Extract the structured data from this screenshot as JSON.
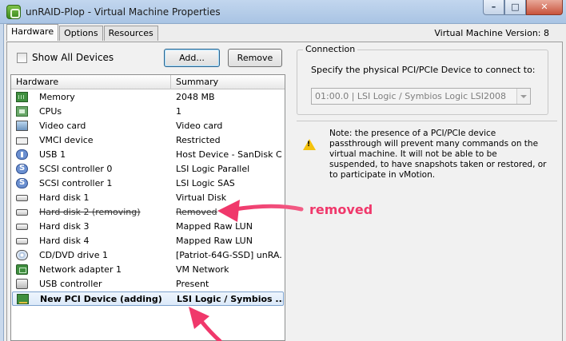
{
  "window": {
    "title": "unRAID-Plop - Virtual Machine Properties"
  },
  "tabs": [
    {
      "label": "Hardware",
      "active": true
    },
    {
      "label": "Options",
      "active": false
    },
    {
      "label": "Resources",
      "active": false
    }
  ],
  "vm_version": "Virtual Machine Version: 8",
  "toolbar": {
    "show_all_devices": "Show All Devices",
    "show_all_devices_checked": false,
    "add_label": "Add...",
    "remove_label": "Remove"
  },
  "device_list": {
    "columns": {
      "hardware": "Hardware",
      "summary": "Summary"
    },
    "rows": [
      {
        "name": "Memory",
        "summary": "2048 MB",
        "icon": "memory-icon"
      },
      {
        "name": "CPUs",
        "summary": "1",
        "icon": "cpu-icon"
      },
      {
        "name": "Video card",
        "summary": "Video card",
        "icon": "video-card-icon"
      },
      {
        "name": "VMCI device",
        "summary": "Restricted",
        "icon": "vmci-icon"
      },
      {
        "name": "USB 1",
        "summary": "Host Device - SanDisk C...",
        "icon": "usb-icon"
      },
      {
        "name": "SCSI controller 0",
        "summary": "LSI Logic Parallel",
        "icon": "scsi-icon"
      },
      {
        "name": "SCSI controller 1",
        "summary": "LSI Logic SAS",
        "icon": "scsi-icon"
      },
      {
        "name": "Hard disk 1",
        "summary": "Virtual Disk",
        "icon": "hard-disk-icon"
      },
      {
        "name": "Hard disk 2 (removing)",
        "summary": "Removed",
        "icon": "hard-disk-icon",
        "state": "removing"
      },
      {
        "name": "Hard disk 3",
        "summary": "Mapped Raw LUN",
        "icon": "hard-disk-icon"
      },
      {
        "name": "Hard disk 4",
        "summary": "Mapped Raw LUN",
        "icon": "hard-disk-icon"
      },
      {
        "name": "CD/DVD drive 1",
        "summary": "[Patriot-64G-SSD] unRA...",
        "icon": "cd-dvd-icon"
      },
      {
        "name": "Network adapter 1",
        "summary": "VM Network",
        "icon": "network-adapter-icon"
      },
      {
        "name": "USB controller",
        "summary": "Present",
        "icon": "usb-controller-icon"
      },
      {
        "name": "New PCI Device (adding)",
        "summary": "LSI Logic / Symbios ...",
        "icon": "pci-device-icon",
        "state": "adding",
        "selected": true
      }
    ]
  },
  "connection": {
    "group_title": "Connection",
    "description": "Specify the physical PCI/PCIe Device to connect to:",
    "selected_device": "01:00.0 | LSI Logic / Symbios Logic LSI2008"
  },
  "note": "Note: the presence of a PCI/PCIe device passthrough will prevent many commands on the virtual machine. It will not be able to be suspended, to have snapshots taken or restored, or to participate in vMotion.",
  "annotation": {
    "label": "removed",
    "color": "#f0386b"
  }
}
